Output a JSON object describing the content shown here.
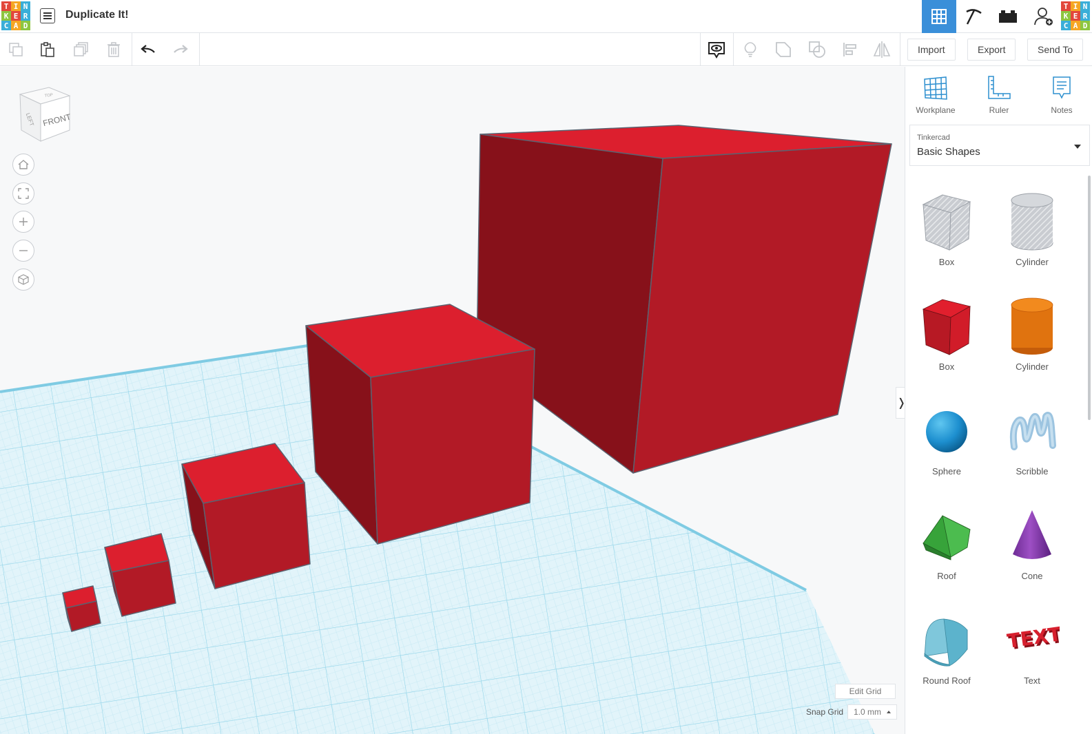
{
  "app": {
    "logo_letters": [
      "T",
      "I",
      "N",
      "K",
      "E",
      "R",
      "C",
      "A",
      "D"
    ],
    "logo_colors": [
      "#e2473b",
      "#f5a623",
      "#3aaed8",
      "#8dc63f",
      "#e2473b",
      "#3aaed8",
      "#3aaed8",
      "#f5a623",
      "#8dc63f"
    ],
    "title": "Duplicate It!"
  },
  "toolbar": {
    "left_icons": [
      "copy-icon",
      "paste-icon",
      "duplicate-icon",
      "delete-icon",
      "undo-icon",
      "redo-icon"
    ],
    "right_icons": [
      "show-hide-icon",
      "lightbulb-icon",
      "group-icon",
      "ungroup-icon",
      "align-icon",
      "mirror-icon"
    ],
    "import_label": "Import",
    "export_label": "Export",
    "send_to_label": "Send To"
  },
  "viewport": {
    "viewcube_face": "FRONT",
    "viewcube_left": "LEFT",
    "viewcube_top": "TOP",
    "nav_icons": [
      "home-view-icon",
      "fit-view-icon",
      "zoom-in-icon",
      "zoom-out-icon",
      "perspective-icon"
    ],
    "edit_grid_label": "Edit Grid",
    "snap_grid_label": "Snap Grid",
    "snap_grid_value": "1.0 mm",
    "panel_toggle": "❭",
    "cube_colors": {
      "top": "#dc1f2e",
      "front": "#b21a26",
      "side": "#87111a",
      "edge": "#5b6270"
    },
    "grid_color": "#8fd3e8"
  },
  "panel": {
    "tools": [
      {
        "label": "Workplane",
        "icon": "workplane-icon"
      },
      {
        "label": "Ruler",
        "icon": "ruler-icon"
      },
      {
        "label": "Notes",
        "icon": "notes-icon"
      }
    ],
    "library_small": "Tinkercad",
    "library_name": "Basic Shapes",
    "shapes": [
      {
        "label": "Box"
      },
      {
        "label": "Cylinder"
      },
      {
        "label": "Box"
      },
      {
        "label": "Cylinder"
      },
      {
        "label": "Sphere"
      },
      {
        "label": "Scribble"
      },
      {
        "label": "Roof"
      },
      {
        "label": "Cone"
      },
      {
        "label": "Round Roof"
      },
      {
        "label": "Text"
      }
    ],
    "accent": "#3a8fd9"
  }
}
